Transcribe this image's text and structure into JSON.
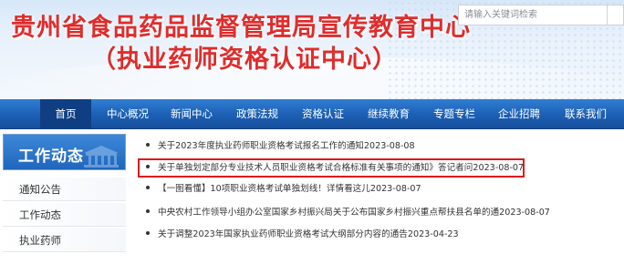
{
  "header": {
    "title_line1": "贵州省食品药品监督管理局宣传教育中心",
    "title_line2": "（执业药师资格认证中心）",
    "search": {
      "placeholder": "请输入关键词检索"
    }
  },
  "nav": {
    "items": [
      {
        "label": "首页",
        "active": true
      },
      {
        "label": "中心概况"
      },
      {
        "label": "新闻中心"
      },
      {
        "label": "政策法规"
      },
      {
        "label": "资格认证"
      },
      {
        "label": "继续教育"
      },
      {
        "label": "专题专栏"
      },
      {
        "label": "企业招聘"
      },
      {
        "label": "联系我们"
      }
    ]
  },
  "sidebar": {
    "title": "工作动态",
    "items": [
      {
        "label": "通知公告"
      },
      {
        "label": "工作动态"
      },
      {
        "label": "执业药师"
      }
    ]
  },
  "news": {
    "items": [
      {
        "title": "关于2023年度执业药师职业资格考试报名工作的通知",
        "date": "2023-08-08"
      },
      {
        "title": "关于单独划定部分专业技术人员职业资格考试合格标准有关事项的通知》答记者问",
        "date": "2023-08-07",
        "highlighted": true
      },
      {
        "title": "【一图看懂】10项职业资格考试单独划线！详情看这儿",
        "date": "2023-08-07"
      },
      {
        "title": "中央农村工作领导小组办公室国家乡村振兴局关于公布国家乡村振兴重点帮扶县名单的通",
        "date": "2023-08-07"
      },
      {
        "title": "关于调整2023年国家执业药师职业资格考试大纲部分内容的通告",
        "date": "2023-04-23"
      }
    ]
  },
  "colors": {
    "title_red": "#e02c2c",
    "nav_blue": "#1c5fb4",
    "nav_active": "#0f3f82",
    "highlight_border": "#e01818"
  },
  "icons": {
    "search": "search-icon",
    "building": "building-icon"
  }
}
